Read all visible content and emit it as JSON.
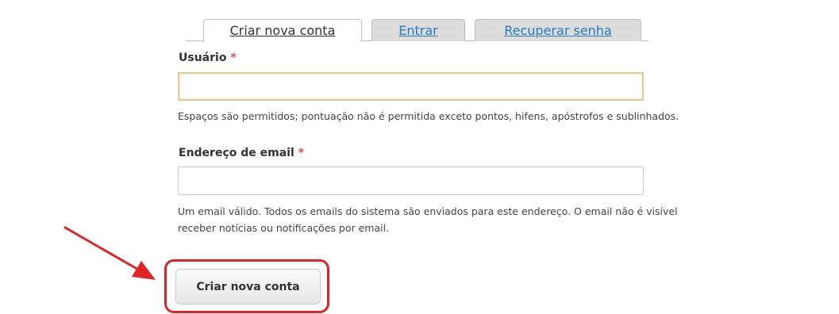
{
  "tabs": [
    {
      "label": "Criar nova conta",
      "active": true
    },
    {
      "label": "Entrar",
      "active": false
    },
    {
      "label": "Recuperar senha",
      "active": false
    }
  ],
  "form": {
    "username": {
      "label": "Usuário",
      "required_mark": "*",
      "value": "",
      "description": "Espaços são permitidos; pontuação não é permitida exceto pontos, hifens, apóstrofos e sublinhados."
    },
    "email": {
      "label": "Endereço de email",
      "required_mark": "*",
      "value": "",
      "description_line1": "Um email válido. Todos os emails do sistema são enviados para este endereço. O email não é visível",
      "description_line2": "receber notícias ou notificações por email."
    },
    "submit_label": "Criar nova conta"
  },
  "colors": {
    "tab_link": "#2a7bbf",
    "required": "#e34b4b",
    "annotation": "#e02424",
    "focus_border": "#e6c88a"
  },
  "icons": {
    "annotation_arrow": "red-arrow-icon"
  }
}
